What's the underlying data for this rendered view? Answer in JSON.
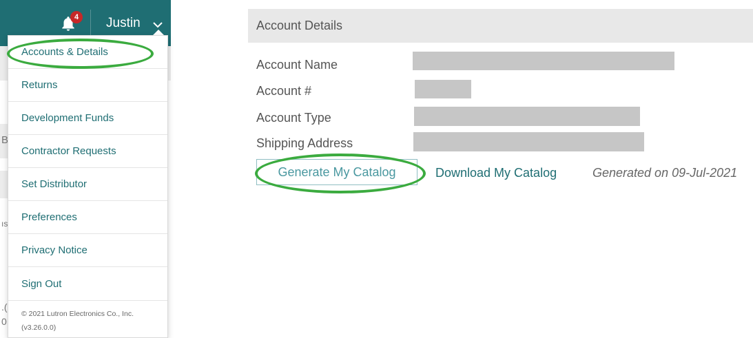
{
  "header": {
    "notification_count": "4",
    "user_name": "Justin"
  },
  "menu": {
    "items": [
      {
        "label": "Accounts & Details"
      },
      {
        "label": "Returns"
      },
      {
        "label": "Development Funds"
      },
      {
        "label": "Contractor Requests"
      },
      {
        "label": "Set Distributor"
      },
      {
        "label": "Preferences"
      },
      {
        "label": "Privacy Notice"
      },
      {
        "label": "Sign Out"
      }
    ],
    "copyright": "© 2021 Lutron Electronics Co., Inc.",
    "version": "(v3.26.0.0)"
  },
  "account_details": {
    "title": "Account Details",
    "fields": [
      {
        "label": "Account Name"
      },
      {
        "label": "Account #"
      },
      {
        "label": "Account Type"
      },
      {
        "label": "Shipping Address"
      }
    ],
    "generate_button": "Generate My Catalog",
    "download_link": "Download My Catalog",
    "generated_note": "Generated on 09-Jul-2021"
  },
  "background_fragments": {
    "frag_a": "B",
    "frag_b": "ıs",
    "frag_c": ".(",
    "frag_d": "0"
  },
  "colors": {
    "brand_teal": "#1f6e73",
    "badge_red": "#c62828",
    "highlight_green": "#3bab3f"
  },
  "icons": {
    "bell": "bell-icon",
    "chevron": "chevron-down-icon"
  }
}
